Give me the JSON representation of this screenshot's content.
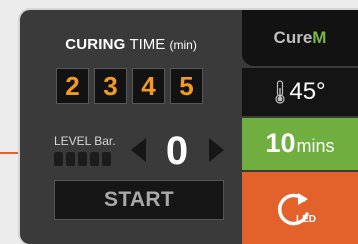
{
  "curing": {
    "title_bold": "CURING",
    "title_rest": "TIME",
    "unit": "(min)",
    "digits": [
      "2",
      "3",
      "4",
      "5"
    ]
  },
  "level": {
    "label": "LEVEL Bar.",
    "value": "0",
    "bar_count": 5
  },
  "start_label": "START",
  "brand": {
    "part1": "Cure",
    "part2": "M"
  },
  "temperature": "45°",
  "time": {
    "value": "10",
    "unit": "mins"
  },
  "led_label": "LED",
  "colors": {
    "accent_orange": "#e3612b",
    "accent_green": "#6fae3f",
    "digit_color": "#f39a23",
    "brand_green": "#7ab648"
  },
  "icons": [
    "thermometer-icon",
    "chevron-left-icon",
    "chevron-right-icon",
    "led-cure-icon"
  ]
}
